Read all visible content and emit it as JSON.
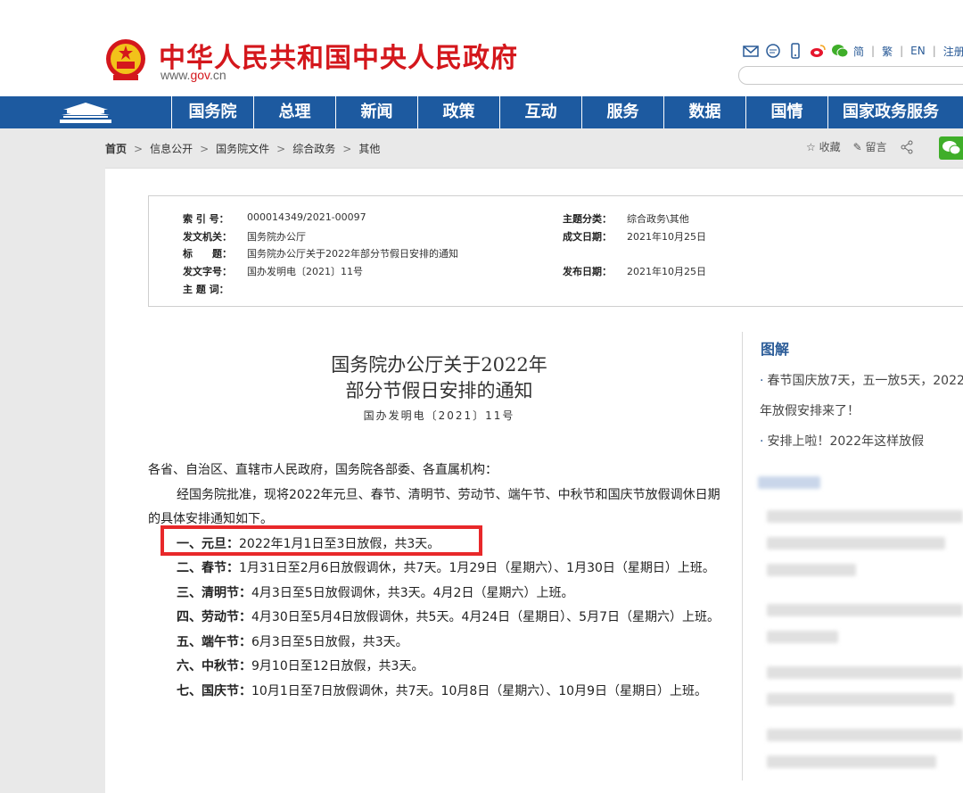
{
  "header": {
    "site_name": "中华人民共和国中央人民政府",
    "site_url_prefix": "www.",
    "site_url_domain": "gov",
    "site_url_suffix": ".cn",
    "lang_links": [
      "简",
      "繁",
      "EN",
      "注册"
    ],
    "search_placeholder": ""
  },
  "nav": {
    "items": [
      "国务院",
      "总理",
      "新闻",
      "政策",
      "互动",
      "服务",
      "数据",
      "国情",
      "国家政务服务"
    ]
  },
  "breadcrumb": [
    "首页",
    "信息公开",
    "国务院文件",
    "综合政务",
    "其他"
  ],
  "page_actions": {
    "favorite": "收藏",
    "comment": "留言"
  },
  "meta": {
    "index_label": "索 引 号：",
    "index_value": "000014349/2021-00097",
    "issuer_label": "发文机关：",
    "issuer_value": "国务院办公厅",
    "title_label": "标　　题：",
    "title_value": "国务院办公厅关于2022年部分节假日安排的通知",
    "doc_num_label": "发文字号：",
    "doc_num_value": "国办发明电〔2021〕11号",
    "keywords_label": "主 题 词：",
    "keywords_value": "",
    "topic_label": "主题分类：",
    "topic_value": "综合政务\\其他",
    "written_label": "成文日期：",
    "written_value": "2021年10月25日",
    "published_label": "发布日期：",
    "published_value": "2021年10月25日"
  },
  "document": {
    "title_line1": "国务院办公厅关于2022年",
    "title_line2": "部分节假日安排的通知",
    "doc_number": "国办发明电〔2021〕11号",
    "salutation": "各省、自治区、直辖市人民政府，国务院各部委、各直属机构：",
    "intro": "经国务院批准，现将2022年元旦、春节、清明节、劳动节、端午节、中秋节和国庆节放假调休日期的具体安排通知如下。",
    "items": [
      {
        "label": "一、元旦：",
        "text": "2022年1月1日至3日放假，共3天。"
      },
      {
        "label": "二、春节：",
        "text": "1月31日至2月6日放假调休，共7天。1月29日（星期六）、1月30日（星期日）上班。"
      },
      {
        "label": "三、清明节：",
        "text": "4月3日至5日放假调休，共3天。4月2日（星期六）上班。"
      },
      {
        "label": "四、劳动节：",
        "text": "4月30日至5月4日放假调休，共5天。4月24日（星期日）、5月7日（星期六）上班。"
      },
      {
        "label": "五、端午节：",
        "text": "6月3日至5日放假，共3天。"
      },
      {
        "label": "六、中秋节：",
        "text": "9月10日至12日放假，共3天。"
      },
      {
        "label": "七、国庆节：",
        "text": "10月1日至7日放假调休，共7天。10月8日（星期六）、10月9日（星期日）上班。"
      }
    ]
  },
  "sidebar": {
    "title": "图解",
    "links": [
      "春节国庆放7天，五一放5天，2022年放假安排来了！",
      "安排上啦！2022年这样放假"
    ]
  },
  "colors": {
    "brand_red": "#d4171c",
    "nav_blue": "#1d5aa0",
    "highlight_red": "#e8282a",
    "link_blue": "#2a5b97"
  }
}
